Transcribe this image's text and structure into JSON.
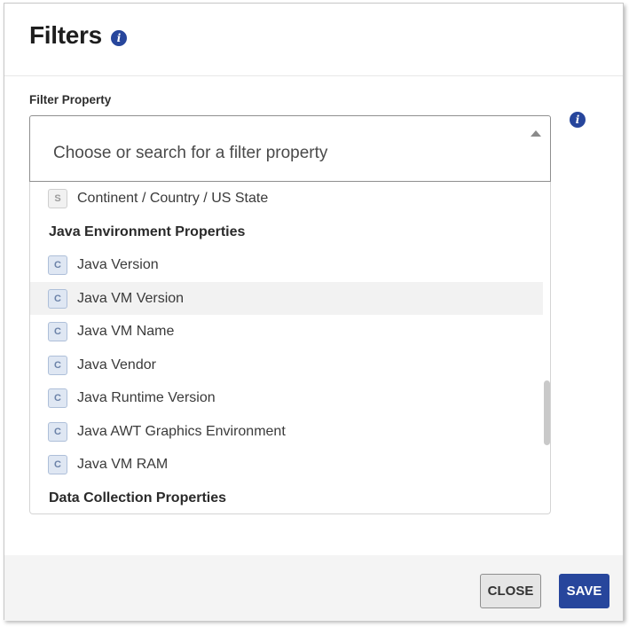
{
  "dialog": {
    "title": "Filters",
    "title_info_icon": "info-icon"
  },
  "filter": {
    "label": "Filter Property",
    "placeholder": "Choose or search for a filter property",
    "side_info_icon": "info-icon"
  },
  "dropdown": {
    "items": [
      {
        "type": "option",
        "badge": "S",
        "label": "Continent / Country / US State"
      },
      {
        "type": "group",
        "label": "Java Environment Properties"
      },
      {
        "type": "option",
        "badge": "C",
        "label": "Java Version"
      },
      {
        "type": "option",
        "badge": "C",
        "label": "Java VM Version",
        "hovered": true
      },
      {
        "type": "option",
        "badge": "C",
        "label": "Java VM Name"
      },
      {
        "type": "option",
        "badge": "C",
        "label": "Java Vendor"
      },
      {
        "type": "option",
        "badge": "C",
        "label": "Java Runtime Version"
      },
      {
        "type": "option",
        "badge": "C",
        "label": "Java AWT Graphics Environment"
      },
      {
        "type": "option",
        "badge": "C",
        "label": "Java VM RAM"
      },
      {
        "type": "group",
        "label": "Data Collection Properties"
      }
    ]
  },
  "footer": {
    "close_label": "CLOSE",
    "save_label": "SAVE"
  },
  "colors": {
    "primary": "#27469c",
    "hover_row": "#f2f2f2",
    "footer_bg": "#f4f4f4"
  }
}
